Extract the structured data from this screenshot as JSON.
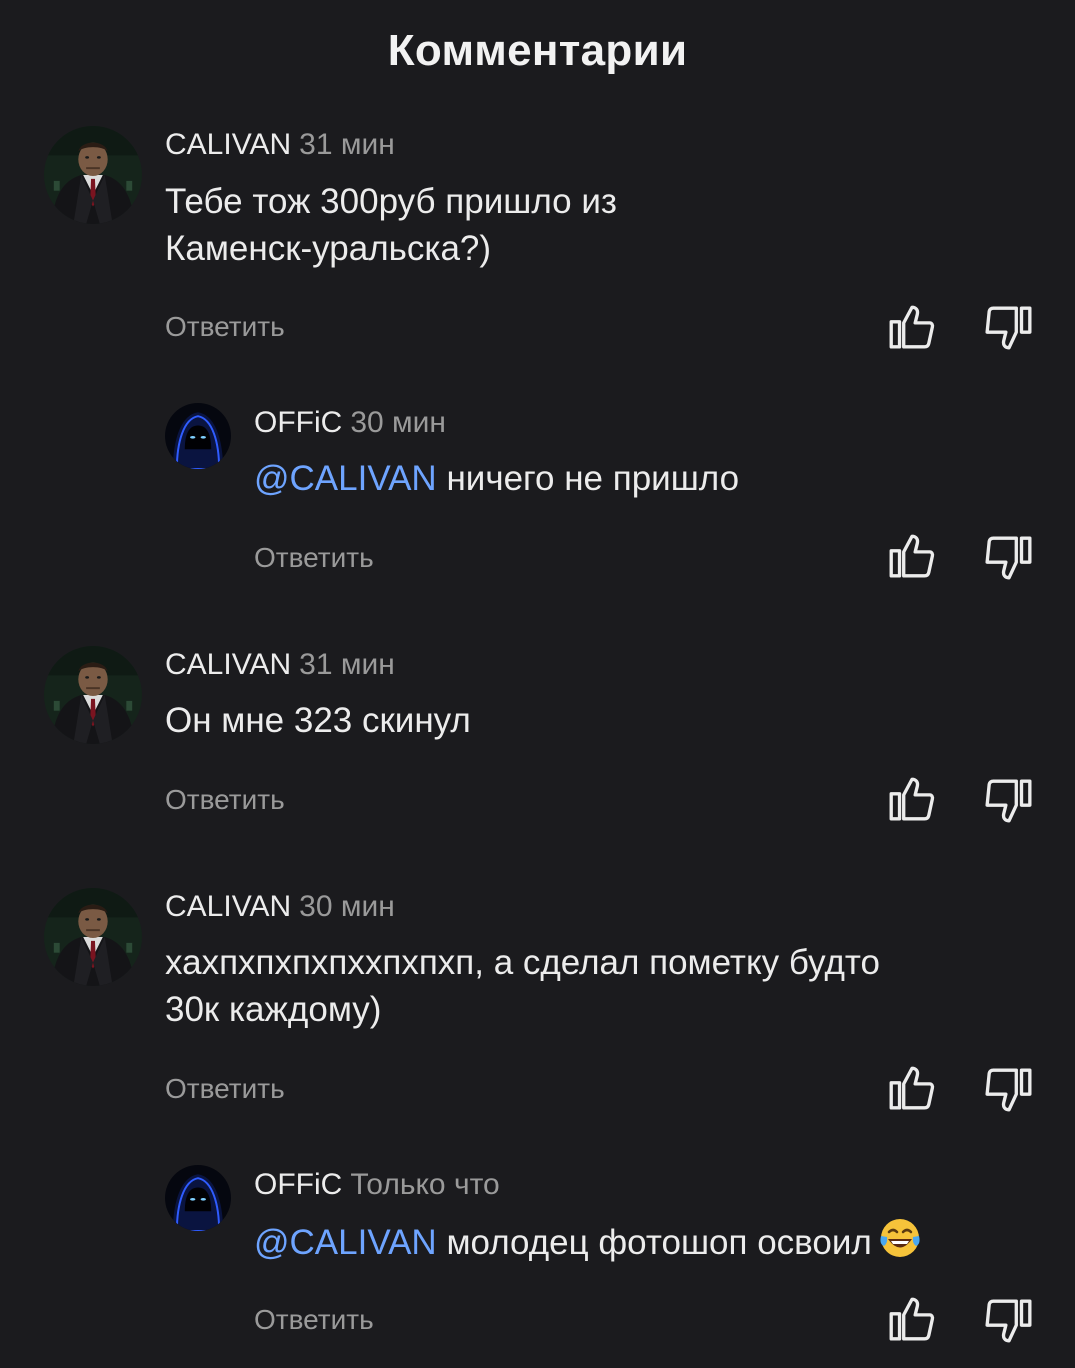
{
  "header": {
    "title": "Комментарии"
  },
  "comments": [
    {
      "author": "CALIVAN",
      "time": "31 мин",
      "mention": "",
      "text": "Тебе тож 300руб пришло из\nКаменск-уральска?)",
      "reply_label": "Ответить",
      "avatar": "man-in-suit-avatar",
      "is_reply": false
    },
    {
      "author": "OFFiC",
      "time": "30 мин",
      "mention": "@CALIVAN",
      "text": "ничего не пришло",
      "reply_label": "Ответить",
      "avatar": "hooded-figure-avatar",
      "is_reply": true
    },
    {
      "author": "CALIVAN",
      "time": "31 мин",
      "mention": "",
      "text": "Он мне 323 скинул",
      "reply_label": "Ответить",
      "avatar": "man-in-suit-avatar",
      "is_reply": false
    },
    {
      "author": "CALIVAN",
      "time": "30 мин",
      "mention": "",
      "text": "хахпхпхпхпххпхпхп, а сделал пометку будто\n30к каждому)",
      "reply_label": "Ответить",
      "avatar": "man-in-suit-avatar",
      "is_reply": false
    },
    {
      "author": "OFFiC",
      "time": "Только что",
      "mention": "@CALIVAN",
      "text": "молодец фотошоп освоил",
      "emoji": "tears-of-joy-emoji",
      "reply_label": "Ответить",
      "avatar": "hooded-figure-avatar",
      "is_reply": true
    }
  ],
  "icons": {
    "like": "thumbs-up-icon",
    "dislike": "thumbs-down-icon"
  },
  "colors": {
    "background": "#1b1b1e",
    "text": "#ececec",
    "secondary_text": "#9a9a9a",
    "mention": "#6ea4ff"
  }
}
